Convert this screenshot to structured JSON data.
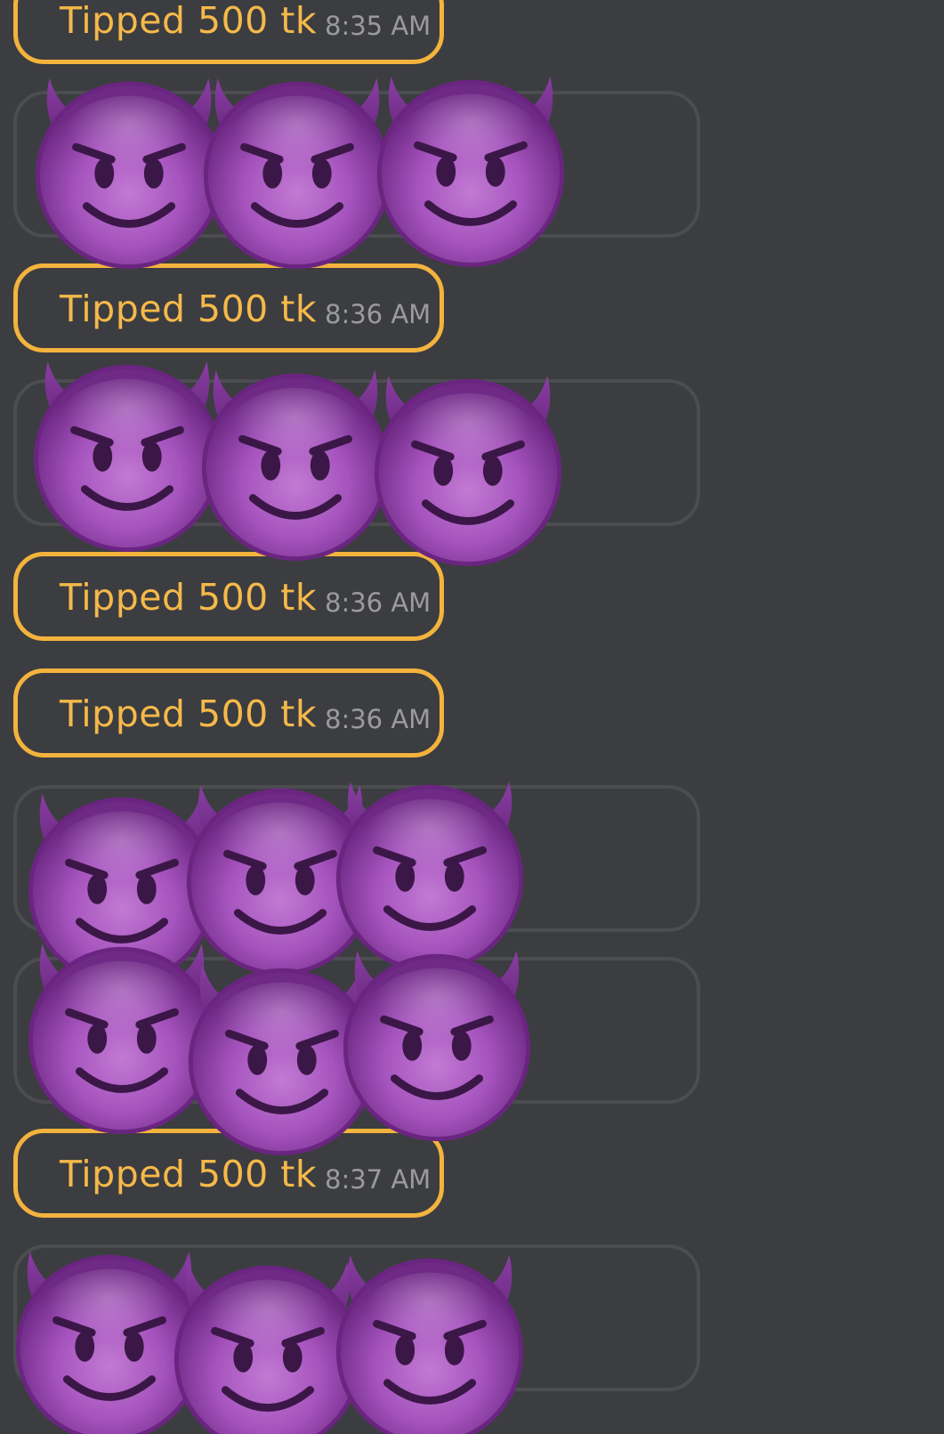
{
  "icons": {
    "reaction": "smiling-face-with-horns-icon"
  },
  "colors": {
    "background": "#3c3d40",
    "tip_accent": "#f3b33d",
    "tip_text": "#f5b94a",
    "timestamp": "#9b9b9e",
    "bubble_border": "#4c4d51",
    "emoji_purple": "#9b4bb0"
  },
  "tips": [
    {
      "label": "Tipped 500 tk",
      "time": "8:35 AM"
    },
    {
      "label": "Tipped 500 tk",
      "time": "8:36 AM"
    },
    {
      "label": "Tipped 500 tk",
      "time": "8:36 AM"
    },
    {
      "label": "Tipped 500 tk",
      "time": "8:36 AM"
    },
    {
      "label": "Tipped 500 tk",
      "time": "8:37 AM"
    }
  ],
  "emoji_messages": [
    {
      "emoji_count": 3
    },
    {
      "emoji_count": 3
    },
    {
      "emoji_count": 3
    },
    {
      "emoji_count": 3
    },
    {
      "emoji_count": 3
    }
  ]
}
